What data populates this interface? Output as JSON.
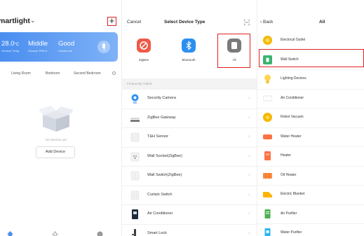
{
  "home": {
    "title": "martlight",
    "weather": {
      "temp_value": "28.0",
      "temp_unit": "°C",
      "temp_label": "Outdoor Temp.",
      "pm_value": "Middle",
      "pm_label": "Outdoor PM2.5",
      "humidity_value": "Good",
      "humidity_label": "Outdoor Air"
    },
    "rooms": [
      "Living Room",
      "Bedroom",
      "Second Bedroom"
    ],
    "empty_text": "No devices yet",
    "add_device_label": "Add Device"
  },
  "select": {
    "cancel_label": "Cancel",
    "title": "Select Device Type",
    "types": [
      {
        "label": "ZigBee",
        "color": "#ee5a4a"
      },
      {
        "label": "Bluetooth",
        "color": "#2b8ff0"
      },
      {
        "label": "All",
        "color": "#7a7a7a"
      }
    ],
    "section_label": "Frequently Added",
    "devices": [
      {
        "label": "Security Camera",
        "icon": "camera-icon"
      },
      {
        "label": "ZigBee Gateway",
        "icon": "gateway-icon"
      },
      {
        "label": "T&H Sensor",
        "icon": "sensor-icon"
      },
      {
        "label": "Wall Socket(ZigBee)",
        "icon": "socket-icon"
      },
      {
        "label": "Wall Switch(ZigBee)",
        "icon": "switch-icon"
      },
      {
        "label": "Curtain Switch",
        "icon": "curtain-icon"
      },
      {
        "label": "Air Conditioner",
        "icon": "ac-icon"
      },
      {
        "label": "Smart Lock",
        "icon": "lock-icon"
      }
    ]
  },
  "all": {
    "back_label": "Back",
    "title": "All",
    "devices": [
      {
        "label": "Electrical Outlet",
        "icon": "outlet-icon",
        "color": "#f5b800"
      },
      {
        "label": "Wall Switch",
        "icon": "wall-switch-icon",
        "color": "#3cb371"
      },
      {
        "label": "Lighting Devices",
        "icon": "bulb-icon",
        "color": "#ffd54f"
      },
      {
        "label": "Air Conditioner",
        "icon": "ac-icon",
        "color": "#8a8a8a"
      },
      {
        "label": "Robot Vacuum",
        "icon": "vacuum-icon",
        "color": "#f5b800"
      },
      {
        "label": "Water Heater",
        "icon": "water-heater-icon",
        "color": "#ff7043"
      },
      {
        "label": "Heater",
        "icon": "heater-icon",
        "color": "#ff7043"
      },
      {
        "label": "Oil Heater",
        "icon": "oil-heater-icon",
        "color": "#ff8a3d"
      },
      {
        "label": "Electric Blanket",
        "icon": "blanket-icon",
        "color": "#ffb300"
      },
      {
        "label": "Air Purifier",
        "icon": "air-purifier-icon",
        "color": "#4caf50"
      },
      {
        "label": "Water Purifier",
        "icon": "water-purifier-icon",
        "color": "#29b6f6"
      }
    ]
  },
  "colors": {
    "accent": "#e02020",
    "brand_blue": "#4a8ef0"
  }
}
